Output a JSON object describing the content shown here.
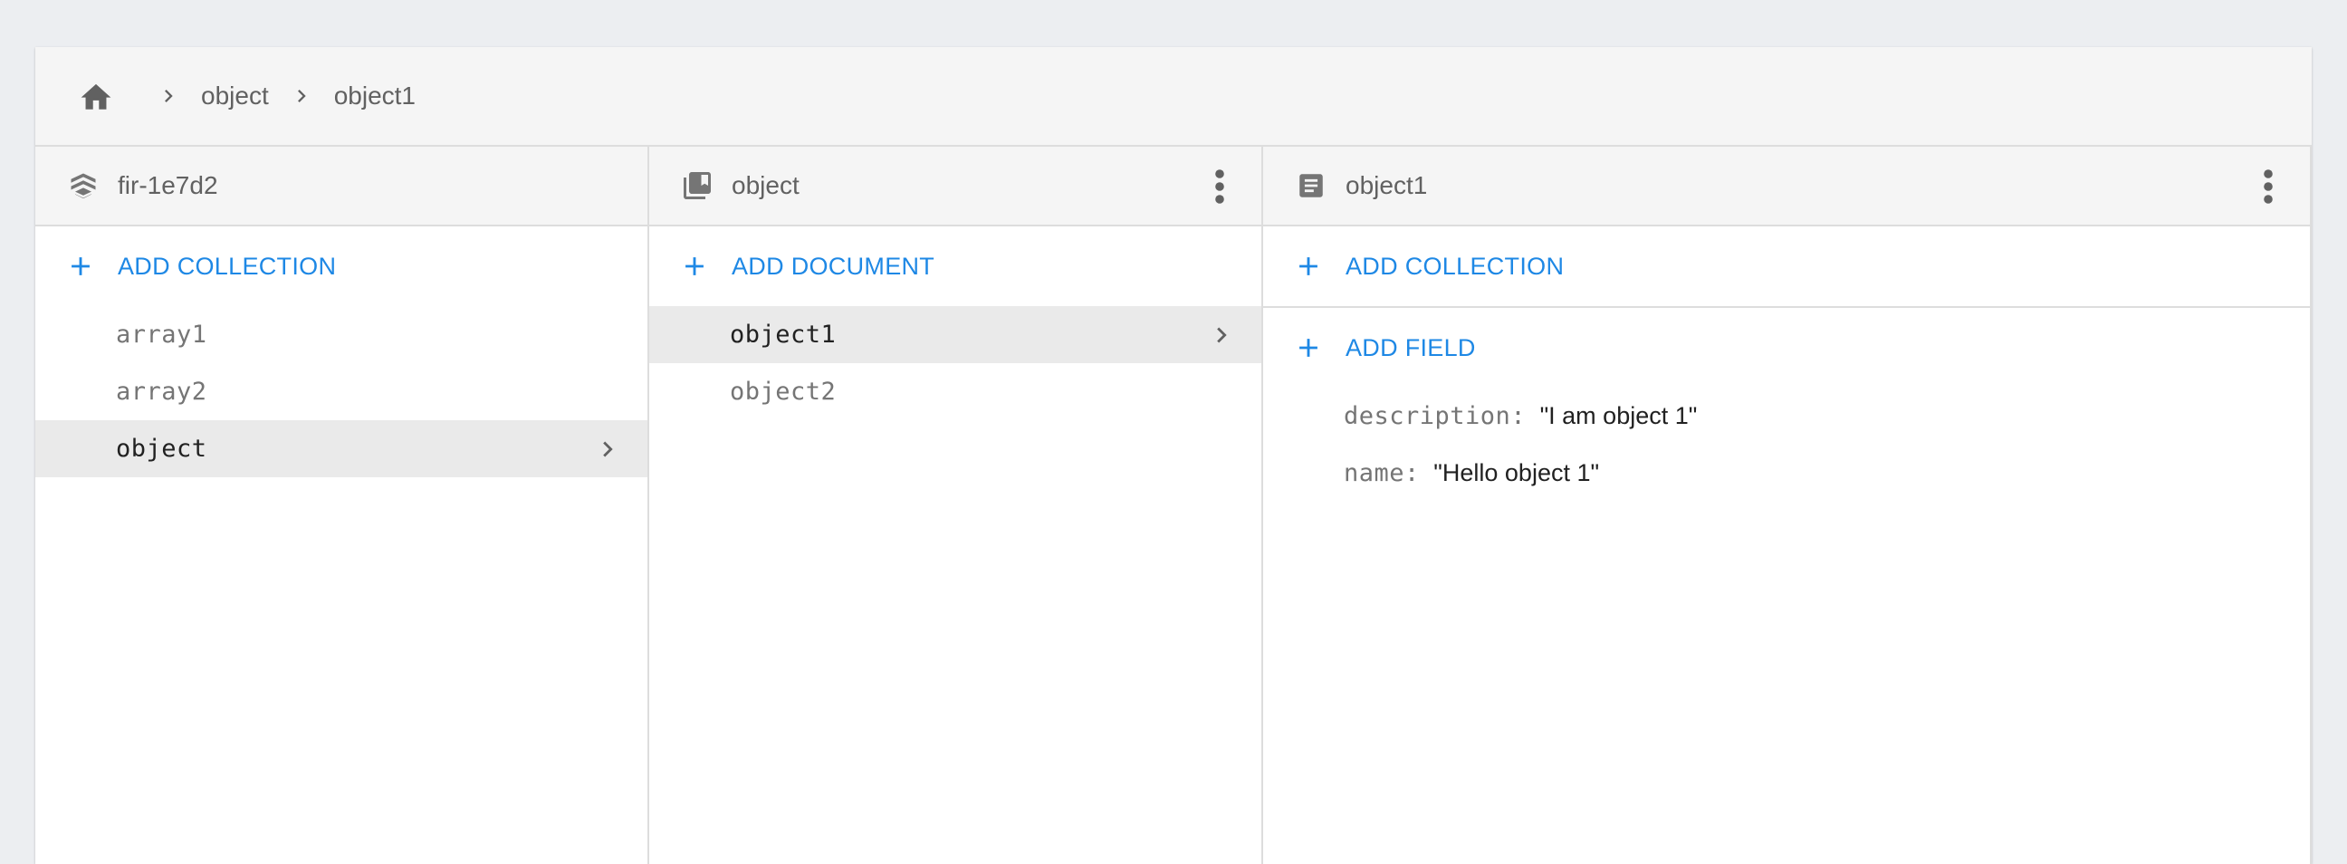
{
  "breadcrumb": {
    "home_icon": "home-icon",
    "items": [
      "object",
      "object1"
    ]
  },
  "columns": {
    "root": {
      "title": "fir-1e7d2",
      "icon": "firestore-icon",
      "action_label": "ADD COLLECTION",
      "items": [
        {
          "label": "array1",
          "selected": false
        },
        {
          "label": "array2",
          "selected": false
        },
        {
          "label": "object",
          "selected": true
        }
      ]
    },
    "collection": {
      "title": "object",
      "icon": "collection-icon",
      "action_label": "ADD DOCUMENT",
      "items": [
        {
          "label": "object1",
          "selected": true
        },
        {
          "label": "object2",
          "selected": false
        }
      ]
    },
    "document": {
      "title": "object1",
      "icon": "document-icon",
      "collection_action_label": "ADD COLLECTION",
      "field_action_label": "ADD FIELD",
      "fields": [
        {
          "key": "description",
          "colon": ":",
          "value": "\"I am object 1\""
        },
        {
          "key": "name",
          "colon": ":",
          "value": "\"Hello object 1\""
        }
      ]
    }
  },
  "colors": {
    "accent": "#1e88e5",
    "header_bg": "#f5f5f5",
    "selected_bg": "#eaeaea",
    "muted_text": "#757575",
    "page_bg": "#eceef1"
  }
}
